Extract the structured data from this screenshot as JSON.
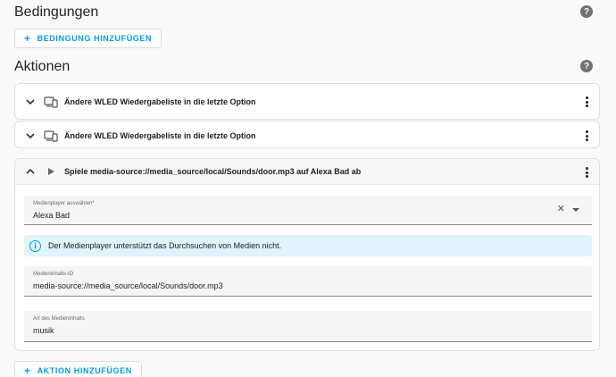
{
  "conditions": {
    "title": "Bedingungen",
    "add_label": "BEDINGUNG HINZUFÜGEN"
  },
  "actions": {
    "title": "Aktionen",
    "add_label": "AKTION HINZUFÜGEN",
    "items": [
      {
        "title": "Ändere WLED Wiedergabeliste in die letzte Option",
        "icon": "device-icon",
        "expanded": false
      },
      {
        "title": "Ändere WLED Wiedergabeliste in die letzte Option",
        "icon": "device-icon",
        "expanded": false
      },
      {
        "title": "Spiele media-source://media_source/local/Sounds/door.mp3 auf Alexa Bad ab",
        "icon": "play-icon",
        "expanded": true,
        "media_player": {
          "label": "Medienplayer auswählen*",
          "value": "Alexa Bad"
        },
        "info": "Der Medienplayer unterstützt das Durchsuchen von Medien nicht.",
        "content_id": {
          "label": "Medieninhalts-ID",
          "value": "media-source://media_source/local/Sounds/door.mp3"
        },
        "content_type": {
          "label": "Art des Medieninhalts",
          "value": "musik"
        }
      }
    ]
  },
  "colors": {
    "accent": "#039be5",
    "info_bg": "#e1f3fb",
    "background": "#fafafa"
  }
}
